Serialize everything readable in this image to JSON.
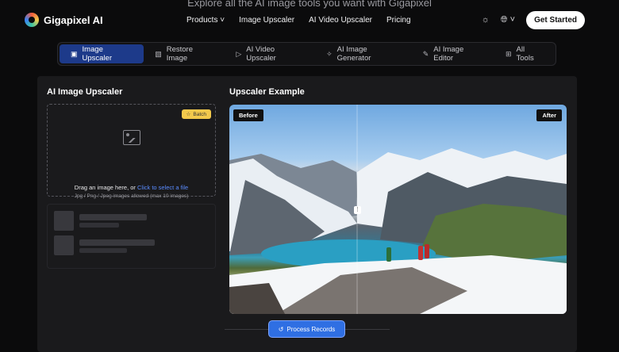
{
  "hero": {
    "text": "Explore all the AI image tools you want with Gigapixel"
  },
  "header": {
    "brand": "Gigapixel AI",
    "nav": [
      {
        "label": "Products ˅"
      },
      {
        "label": "Image Upscaler"
      },
      {
        "label": "AI Video Upscaler"
      },
      {
        "label": "Pricing"
      }
    ],
    "theme_icon": "sun-icon",
    "language_icon": "globe-icon",
    "language_caret": "˅",
    "cta": "Get Started"
  },
  "tabs": [
    {
      "label": "Image Upscaler",
      "icon": "▣",
      "active": true
    },
    {
      "label": "Restore Image",
      "icon": "▧",
      "active": false
    },
    {
      "label": "AI Video Upscaler",
      "icon": "▷",
      "active": false
    },
    {
      "label": "AI Image Generator",
      "icon": "✧",
      "active": false
    },
    {
      "label": "AI Image Editor",
      "icon": "✎",
      "active": false
    },
    {
      "label": "All Tools",
      "icon": "⊞",
      "active": false
    }
  ],
  "upload": {
    "title": "AI Image Upscaler",
    "batch_label": "Batch",
    "drop_text": "Drag an image here, or ",
    "drop_link": "Click to select a file",
    "drop_sub": "Jpg / Png / Jpeg images allowed (max 10 images)"
  },
  "example": {
    "title": "Upscaler Example",
    "before_label": "Before",
    "after_label": "After",
    "handle_glyph": "⋮"
  },
  "process": {
    "label": "Process Records",
    "icon": "↺"
  },
  "colors": {
    "accent": "#2f6fe3",
    "tab_active": "#1d3a8a",
    "batch": "#f2c94c"
  }
}
